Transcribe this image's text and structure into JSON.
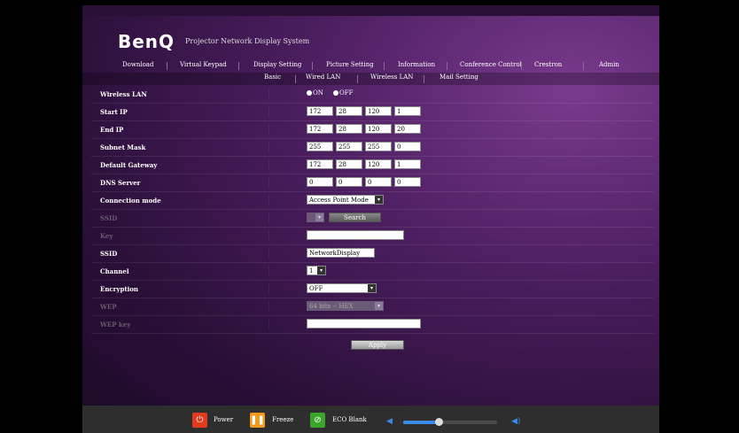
{
  "header": {
    "brand": "BenQ",
    "system_name": "Projector Network Display System"
  },
  "nav": {
    "items": [
      "Download",
      "Virtual Keypad",
      "Display Setting",
      "Picture Setting",
      "Information",
      "Conference Control",
      "Crestron",
      "Admin"
    ]
  },
  "subnav": {
    "items": [
      "Basic",
      "Wired LAN",
      "Wireless LAN",
      "Mail Setting"
    ]
  },
  "form": {
    "wireless_lan": {
      "label": "Wireless LAN",
      "on": "ON",
      "off": "OFF"
    },
    "start_ip": {
      "label": "Start IP",
      "values": [
        "172",
        "28",
        "120",
        "1"
      ]
    },
    "end_ip": {
      "label": "End IP",
      "values": [
        "172",
        "28",
        "120",
        "20"
      ]
    },
    "subnet_mask": {
      "label": "Subnet Mask",
      "values": [
        "255",
        "255",
        "255",
        "0"
      ]
    },
    "default_gateway": {
      "label": "Default Gateway",
      "values": [
        "172",
        "28",
        "120",
        "1"
      ]
    },
    "dns_server": {
      "label": "DNS Server",
      "values": [
        "0",
        "0",
        "0",
        "0"
      ]
    },
    "connection_mode": {
      "label": "Connection mode",
      "value": "Access Point Mode"
    },
    "ssid_search": {
      "label": "SSID",
      "button": "Search"
    },
    "key": {
      "label": "Key",
      "value": ""
    },
    "ssid": {
      "label": "SSID",
      "value": "NetworkDisplay"
    },
    "channel": {
      "label": "Channel",
      "value": "1"
    },
    "encryption": {
      "label": "Encryption",
      "value": "OFF"
    },
    "wep": {
      "label": "WEP",
      "value": "64 bits -- HEX"
    },
    "wep_key": {
      "label": "WEP key",
      "value": ""
    },
    "apply": "Apply"
  },
  "footer": {
    "power": "Power",
    "freeze": "Freeze",
    "eco_blank": "ECO Blank",
    "volume_level": 0.38,
    "colors": {
      "power": "#e23a1e",
      "freeze": "#f29a1c",
      "eco": "#3aa52a",
      "accent": "#3a8ae6"
    }
  }
}
